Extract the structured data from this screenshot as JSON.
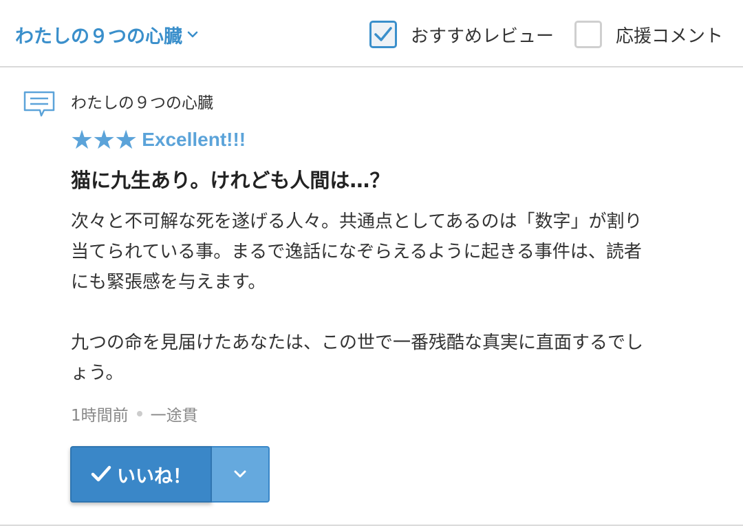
{
  "header": {
    "work_selector_label": "わたしの９つの心臓",
    "filters": {
      "recommended_label": "おすすめレビュー",
      "recommended_checked": true,
      "cheer_label": "応援コメント",
      "cheer_checked": false
    }
  },
  "review": {
    "work_name": "わたしの９つの心臓",
    "stars": "★★★",
    "star_count": 3,
    "rating_label": "Excellent!!!",
    "title": "猫に九生あり。けれども人間は…？",
    "body_paragraph_1_line_1": "次々と不可解な死を遂げる人々。共通点としてあるのは「数字」が割り",
    "body_paragraph_1_line_2": "当てられている事。まるで逸話になぞらえるように起きる事件は、読者",
    "body_paragraph_1_line_3": "にも緊張感を与えます。",
    "body_paragraph_2_line_1": "九つの命を見届けたあなたは、この世で一番残酷な真実に直面するでし",
    "body_paragraph_2_line_2": "ょう。",
    "time_ago": "1時間前",
    "author": "一途貫",
    "like_label": "いいね！"
  },
  "colors": {
    "accent": "#3a8fcb",
    "star": "#5ba3d9",
    "like_button": "#3a87c8",
    "like_more_button": "#65a9de"
  },
  "icons": [
    "chevron-down-icon",
    "checkmark-icon",
    "comment-icon",
    "star-icon"
  ]
}
